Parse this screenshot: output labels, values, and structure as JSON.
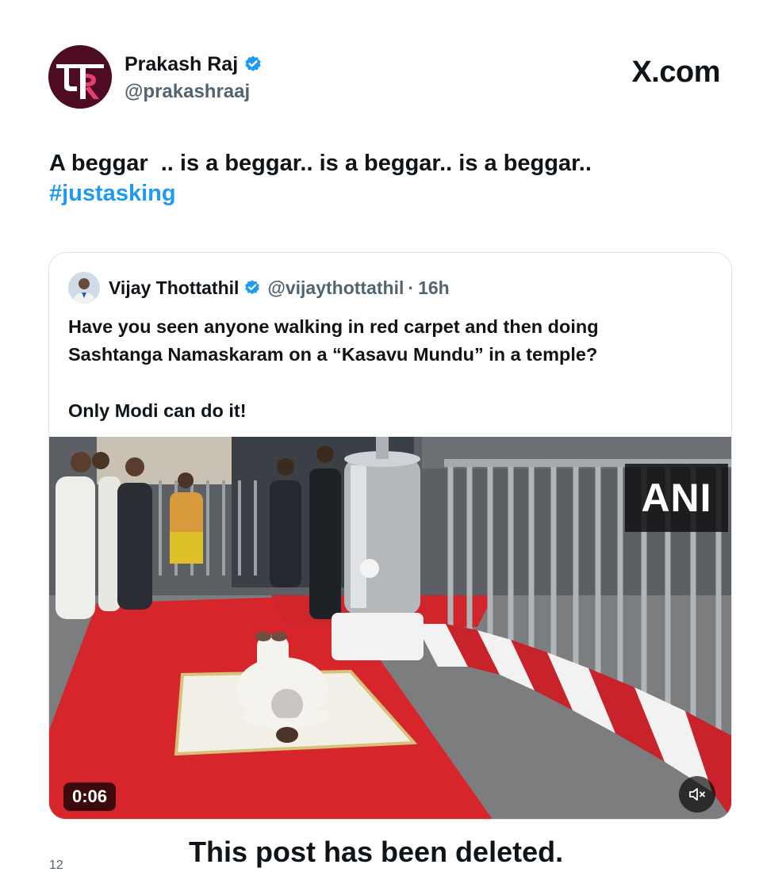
{
  "site_label": "X.com",
  "post": {
    "author_name": "Prakash Raj",
    "author_handle": "@prakashraaj",
    "avatar_text": "प्र",
    "text_lines": [
      "A beggar  .. is a beggar.. is a beggar.. is a beggar.."
    ],
    "hashtag": "#justasking"
  },
  "quoted_post": {
    "author_name": "Vijay Thottathil",
    "author_handle": "@vijaythottathil",
    "separator": "·",
    "time_ago": "16h",
    "text_lines": [
      "Have you seen anyone walking in red carpet and then doing",
      "Sashtanga Namaskaram on a “Kasavu Mundu” in a temple?"
    ],
    "text_line_final": "Only Modi can do it!",
    "video": {
      "watermark": "ANI",
      "duration": "0:06",
      "muted": true
    }
  },
  "deleted_notice": "This post has been deleted.",
  "corner_count": "12",
  "colors": {
    "link_blue": "#1d9bf0",
    "verified_blue": "#1d9bf0",
    "secondary_text": "#536471",
    "carpet_red": "#d6262b",
    "avatar_maroon": "#5a0f29"
  },
  "icons": {
    "verified": "verified-badge-icon",
    "mute": "speaker-muted-icon"
  }
}
